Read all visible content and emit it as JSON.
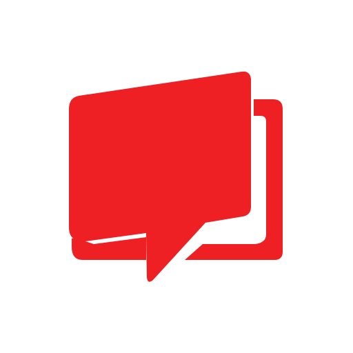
{
  "icon": {
    "name": "chat-bubbles-icon",
    "color": "#ee2024",
    "background": "#ffffff"
  }
}
